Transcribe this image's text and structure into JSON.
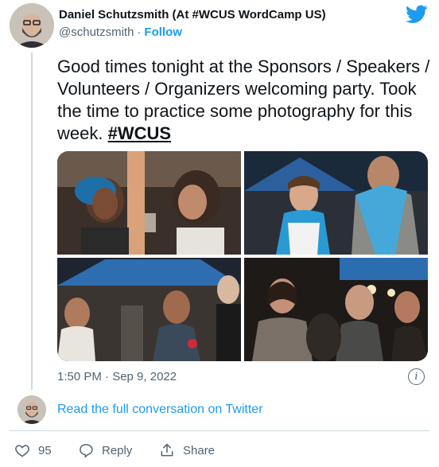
{
  "author": {
    "name": "Daniel Schutzsmith (At #WCUS WordCamp US)",
    "handle": "@schutzsmith",
    "separator": "·",
    "follow_label": "Follow"
  },
  "tweet": {
    "text": "Good times tonight at the Sponsors / Speakers / Volunteers / Organizers welcoming party. Took the time to practice some photography for this week.",
    "hashtag": "#WCUS",
    "timestamp": "1:50 PM · Sep 9, 2022",
    "info_glyph": "i"
  },
  "thread": {
    "read_more_label": "Read the full conversation on Twitter"
  },
  "actions": {
    "like_count": "95",
    "reply_label": "Reply",
    "share_label": "Share"
  },
  "colors": {
    "accent": "#1d9bf0",
    "text": "#0f1419",
    "muted": "#536471",
    "border": "#cfd9de"
  },
  "icons": [
    "twitter-bird-icon",
    "info-icon",
    "heart-icon",
    "reply-bubble-icon",
    "share-icon"
  ]
}
